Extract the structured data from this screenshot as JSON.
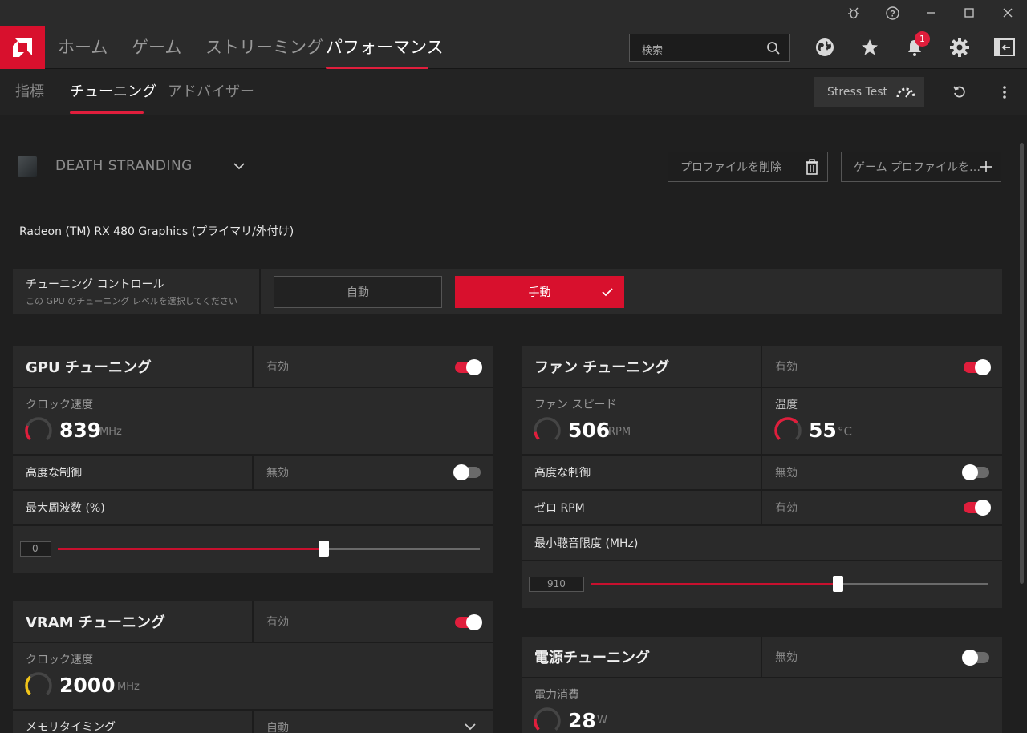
{
  "window": {
    "bug_icon": "bug-icon",
    "help_icon": "help-icon",
    "minimize_icon": "minimize-icon",
    "maximize_icon": "maximize-icon",
    "close_icon": "close-icon"
  },
  "nav": {
    "tabs": [
      {
        "label": "ホーム"
      },
      {
        "label": "ゲーム"
      },
      {
        "label": "ストリーミング"
      },
      {
        "label": "パフォーマンス"
      }
    ],
    "active_tab": "パフォーマンス",
    "search_placeholder": "検索",
    "notification_count": "1",
    "accent_color": "#e01e3c"
  },
  "subnav": {
    "tabs": [
      {
        "label": "指標"
      },
      {
        "label": "チューニング"
      },
      {
        "label": "アドバイザー"
      }
    ],
    "active_tab": "チューニング",
    "stress_test_label": "Stress Test"
  },
  "profile": {
    "game_name": "DEATH STRANDING",
    "delete_profile_label": "プロファイルを削除",
    "game_profile_label": "ゲーム プロファイルを…"
  },
  "gpu_name": "Radeon (TM) RX 480 Graphics (プライマリ/外付け)",
  "tuning_control": {
    "title": "チューニング コントロール",
    "description": "この GPU のチューニング レベルを選択してください",
    "auto_label": "自動",
    "manual_label": "手動",
    "selected": "手動"
  },
  "gpu_tuning": {
    "title": "GPU チューニング",
    "state": "有効",
    "enabled": true,
    "clock_label": "クロック速度",
    "clock_value": "839",
    "clock_unit": "MHz",
    "advanced_label": "高度な制御",
    "advanced_state": "無効",
    "advanced_enabled": false,
    "max_freq_label": "最大周波数 (%)",
    "max_freq_box": "0",
    "slider_fraction": 0.63
  },
  "vram_tuning": {
    "title": "VRAM チューニング",
    "state": "有効",
    "enabled": true,
    "clock_label": "クロック速度",
    "clock_value": "2000",
    "clock_unit": "MHz",
    "memory_timing_label": "メモリタイミング",
    "memory_timing_value": "自動"
  },
  "fan_tuning": {
    "title": "ファン チューニング",
    "state": "有効",
    "enabled": true,
    "fan_speed_label": "ファン スピード",
    "fan_speed_value": "506",
    "fan_speed_unit": "RPM",
    "temp_label": "温度",
    "temp_value": "55",
    "temp_unit": "°C",
    "advanced_label": "高度な制御",
    "advanced_state": "無効",
    "advanced_enabled": false,
    "zero_rpm_label": "ゼロ RPM",
    "zero_rpm_state": "有効",
    "zero_rpm_enabled": true,
    "min_acoustic_label": "最小聴音限度 (MHz)",
    "min_acoustic_box": "910",
    "slider_fraction": 0.62
  },
  "power_tuning": {
    "title": "電源チューニング",
    "state": "無効",
    "enabled": false,
    "power_label": "電力消費",
    "power_value": "28",
    "power_unit": "W"
  }
}
